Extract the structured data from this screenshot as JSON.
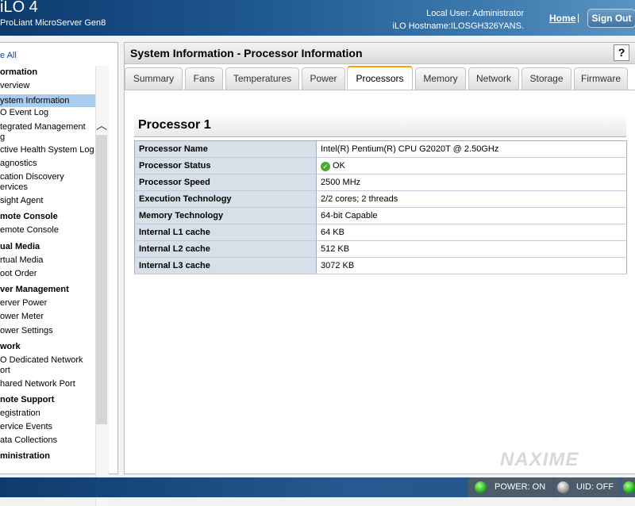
{
  "header": {
    "brand_title": "iLO 4",
    "brand_sub": "ProLiant MicroServer Gen8",
    "local_user": "Local User:  Administrator",
    "hostname": "iLO Hostname:ILOSGH326YANS.",
    "home_label": "Home",
    "separator": "|",
    "signout_label": "Sign Out"
  },
  "sidebar": {
    "collapse_label": "e All",
    "sections": [
      {
        "label": "ormation"
      },
      {
        "label": "mote Console"
      },
      {
        "label": "ual Media"
      },
      {
        "label": "ver Management"
      },
      {
        "label": "work"
      },
      {
        "label": "note Support"
      },
      {
        "label": "ministration"
      }
    ],
    "items": [
      {
        "label": "verview"
      },
      {
        "label": "ystem Information"
      },
      {
        "label": "O Event Log"
      },
      {
        "label": "tegrated Management"
      },
      {
        "label": "g"
      },
      {
        "label": "ctive Health System Log"
      },
      {
        "label": "agnostics"
      },
      {
        "label": "cation Discovery"
      },
      {
        "label": "ervices"
      },
      {
        "label": "sight Agent"
      },
      {
        "label": "emote Console"
      },
      {
        "label": "rtual Media"
      },
      {
        "label": "oot Order"
      },
      {
        "label": "erver Power"
      },
      {
        "label": "ower Meter"
      },
      {
        "label": "ower Settings"
      },
      {
        "label": "O Dedicated Network"
      },
      {
        "label": "ort"
      },
      {
        "label": "hared Network Port"
      },
      {
        "label": "egistration"
      },
      {
        "label": "ervice Events"
      },
      {
        "label": "ata Collections"
      }
    ],
    "scroll_up": "︿",
    "scroll_down": "﹀"
  },
  "main": {
    "page_title": "System Information - Processor Information",
    "help_label": "?",
    "tabs": [
      {
        "label": "Summary"
      },
      {
        "label": "Fans"
      },
      {
        "label": "Temperatures"
      },
      {
        "label": "Power"
      },
      {
        "label": "Processors"
      },
      {
        "label": "Memory"
      },
      {
        "label": "Network"
      },
      {
        "label": "Storage"
      },
      {
        "label": "Firmware"
      }
    ],
    "active_tab": "Processors",
    "processor_title": "Processor 1",
    "rows": [
      {
        "key": "Processor Name",
        "value": "Intel(R) Pentium(R) CPU G2020T @ 2.50GHz"
      },
      {
        "key": "Processor Status",
        "value": "OK"
      },
      {
        "key": "Processor Speed",
        "value": "2500 MHz"
      },
      {
        "key": "Execution Technology",
        "value": "2/2 cores; 2 threads"
      },
      {
        "key": "Memory Technology",
        "value": "64-bit Capable"
      },
      {
        "key": "Internal L1 cache",
        "value": "64 KB"
      },
      {
        "key": "Internal L2 cache",
        "value": "512 KB"
      },
      {
        "key": "Internal L3 cache",
        "value": "3072 KB"
      }
    ],
    "status_ok_glyph": "✓",
    "watermark": "NAXIME"
  },
  "footer": {
    "power_label": "POWER: ON",
    "uid_label": "UID: OFF",
    "colors": {
      "power_led": "#11a313",
      "uid_led": "#888888"
    }
  }
}
